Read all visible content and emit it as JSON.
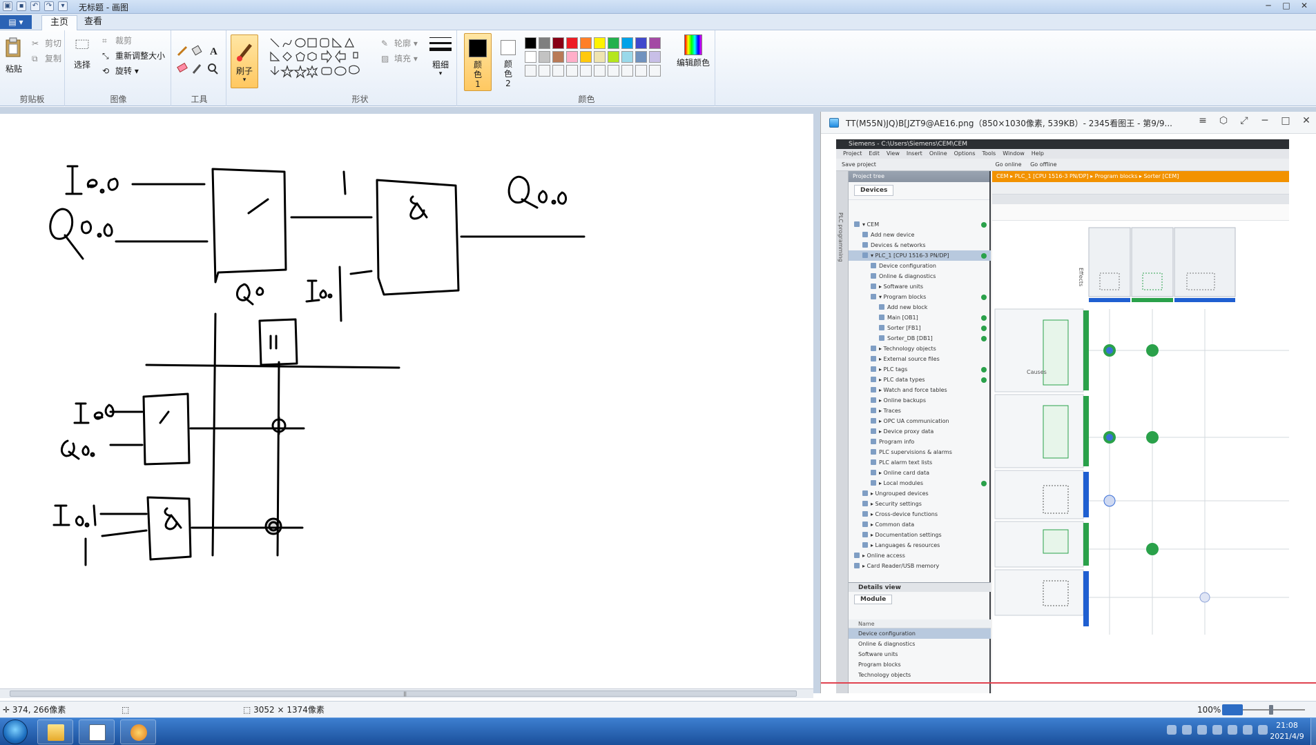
{
  "titlebar": {
    "title": "无标题 - 画图",
    "qat_icons": [
      "save-icon",
      "undo-icon",
      "redo-icon"
    ],
    "controls": [
      "─",
      "□",
      "✕"
    ]
  },
  "ribbon_tabs": {
    "file_label": "▤ ▾",
    "tabs": [
      "主页",
      "查看"
    ]
  },
  "ribbon": {
    "clipboard": {
      "paste": "粘贴",
      "cut": "剪切",
      "copy": "复制",
      "label": "剪贴板"
    },
    "image": {
      "select": "选择",
      "crop": "裁剪",
      "resize": "重新调整大小",
      "rotate": "旋转 ▾",
      "label": "图像"
    },
    "tools": {
      "label": "工具"
    },
    "brushes": {
      "label": "刷子"
    },
    "shapes": {
      "outline": "轮廓 ▾",
      "fill": "填充 ▾",
      "label": "形状"
    },
    "size": {
      "label": "粗细"
    },
    "colors": {
      "color1": "颜色 1",
      "color2": "颜色 2",
      "edit": "编辑颜色",
      "label": "颜色",
      "palette_row1": [
        "#000000",
        "#7f7f7f",
        "#880015",
        "#ed1c24",
        "#ff7f27",
        "#fff200",
        "#22b14c",
        "#00a2e8",
        "#3f48cc",
        "#a349a4"
      ],
      "palette_row2": [
        "#ffffff",
        "#c3c3c3",
        "#b97a57",
        "#ffaec9",
        "#ffc90e",
        "#efe4b0",
        "#b5e61d",
        "#99d9ea",
        "#7092be",
        "#c8bfe7"
      ]
    }
  },
  "viewer": {
    "title": "TT(M55N)JQ)B[JZT9@AE16.png（850×1030像素, 539KB）- 2345看图王 - 第9/9...",
    "controls": [
      "≡",
      "⬡",
      "⤢",
      "─",
      "□",
      "✕"
    ]
  },
  "tia": {
    "title": "Siemens - C:\\Users\\Siemens\\CEM\\CEM",
    "menu": [
      "Project",
      "Edit",
      "View",
      "Insert",
      "Online",
      "Options",
      "Tools",
      "Window",
      "Help"
    ],
    "toolbar": [
      "Save project",
      "Go online",
      "Go offline"
    ],
    "side_label": "PLC programming",
    "tree_header": "Project tree",
    "tree_tab": "Devices",
    "tree_items": [
      {
        "label": "▾ CEM",
        "indent": 0,
        "status": true
      },
      {
        "label": "Add new device",
        "indent": 1,
        "status": false
      },
      {
        "label": "Devices & networks",
        "indent": 1,
        "status": false
      },
      {
        "label": "▾ PLC_1 [CPU 1516-3 PN/DP]",
        "indent": 1,
        "status": true,
        "selected": true
      },
      {
        "label": "Device configuration",
        "indent": 2,
        "status": false
      },
      {
        "label": "Online & diagnostics",
        "indent": 2,
        "status": false
      },
      {
        "label": "▸ Software units",
        "indent": 2,
        "status": false
      },
      {
        "label": "▾ Program blocks",
        "indent": 2,
        "status": true
      },
      {
        "label": "Add new block",
        "indent": 3,
        "status": false
      },
      {
        "label": "Main [OB1]",
        "indent": 3,
        "status": true
      },
      {
        "label": "Sorter [FB1]",
        "indent": 3,
        "status": true
      },
      {
        "label": "Sorter_DB [DB1]",
        "indent": 3,
        "status": true
      },
      {
        "label": "▸ Technology objects",
        "indent": 2,
        "status": false
      },
      {
        "label": "▸ External source files",
        "indent": 2,
        "status": false
      },
      {
        "label": "▸ PLC tags",
        "indent": 2,
        "status": true
      },
      {
        "label": "▸ PLC data types",
        "indent": 2,
        "status": true
      },
      {
        "label": "▸ Watch and force tables",
        "indent": 2,
        "status": false
      },
      {
        "label": "▸ Online backups",
        "indent": 2,
        "status": false
      },
      {
        "label": "▸ Traces",
        "indent": 2,
        "status": false
      },
      {
        "label": "▸ OPC UA communication",
        "indent": 2,
        "status": false
      },
      {
        "label": "▸ Device proxy data",
        "indent": 2,
        "status": false
      },
      {
        "label": "Program info",
        "indent": 2,
        "status": false
      },
      {
        "label": "PLC supervisions & alarms",
        "indent": 2,
        "status": false
      },
      {
        "label": "PLC alarm text lists",
        "indent": 2,
        "status": false
      },
      {
        "label": "▸ Online card data",
        "indent": 2,
        "status": false
      },
      {
        "label": "▸ Local modules",
        "indent": 2,
        "status": true
      },
      {
        "label": "▸ Ungrouped devices",
        "indent": 1,
        "status": false
      },
      {
        "label": "▸ Security settings",
        "indent": 1,
        "status": false
      },
      {
        "label": "▸ Cross-device functions",
        "indent": 1,
        "status": false
      },
      {
        "label": "▸ Common data",
        "indent": 1,
        "status": false
      },
      {
        "label": "▸ Documentation settings",
        "indent": 1,
        "status": false
      },
      {
        "label": "▸ Languages & resources",
        "indent": 1,
        "status": false
      },
      {
        "label": "▸ Online access",
        "indent": 0,
        "status": false
      },
      {
        "label": "▸ Card Reader/USB memory",
        "indent": 0,
        "status": false
      }
    ],
    "details_header": "Details view",
    "details_tab": "Module",
    "details_col": "Name",
    "details_items": [
      "Device configuration",
      "Online & diagnostics",
      "Software units",
      "Program blocks",
      "Technology objects"
    ],
    "breadcrumb": "CEM ▸ PLC_1 [CPU 1516-3 PN/DP] ▸ Program blocks ▸ Sorter [CEM]",
    "causes_label": "Causes",
    "effects_label": "Effects"
  },
  "statusbar": {
    "cursor": "374, 266像素",
    "size": "3052 × 1374像素",
    "zoom": "100%"
  },
  "taskbar": {
    "time": "21:08",
    "date": "2021/4/9"
  }
}
